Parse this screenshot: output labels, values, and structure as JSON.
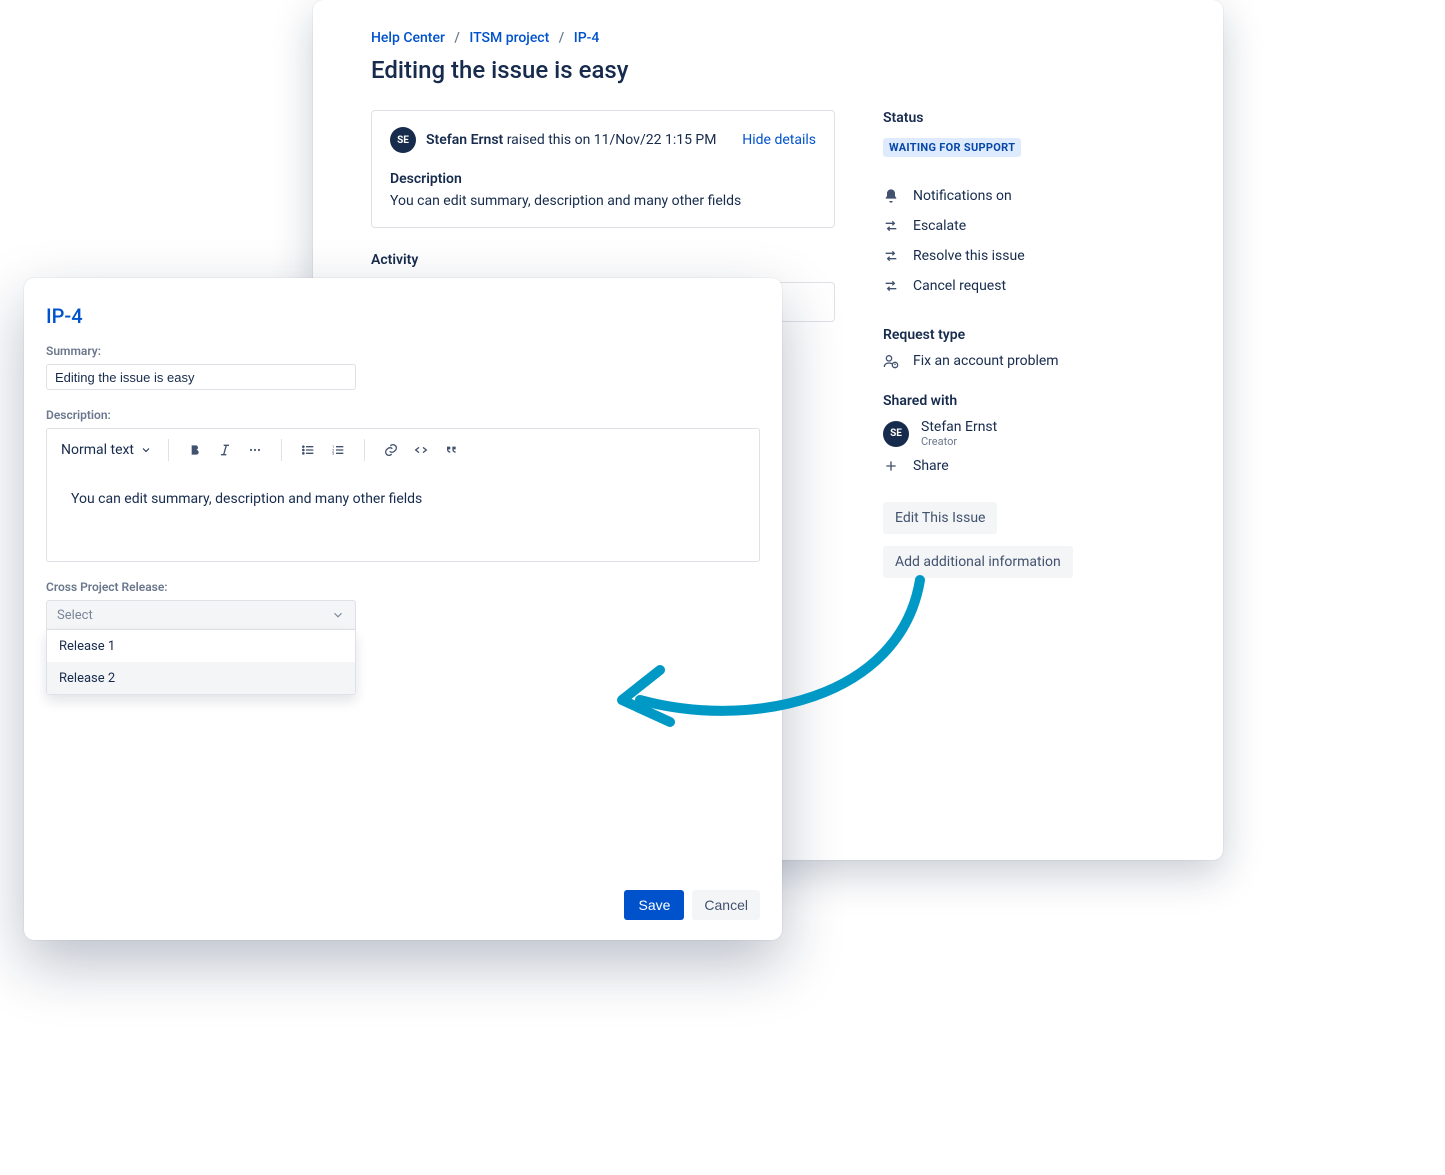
{
  "breadcrumb": {
    "help_center": "Help Center",
    "project": "ITSM project",
    "key": "IP-4"
  },
  "issue": {
    "title": "Editing the issue is easy",
    "raiser_initials": "SE",
    "raiser_name": "Stefan Ernst",
    "raised_mid": " raised this on ",
    "raised_on": "11/Nov/22 1:15 PM",
    "hide_details": "Hide details",
    "description_label": "Description",
    "description_text": "You can edit summary, description and many other fields",
    "activity_label": "Activity"
  },
  "sidebar": {
    "status_label": "Status",
    "status_value": "WAITING FOR SUPPORT",
    "actions": [
      {
        "icon": "bell",
        "label": "Notifications on"
      },
      {
        "icon": "swap",
        "label": "Escalate"
      },
      {
        "icon": "swap",
        "label": "Resolve this issue"
      },
      {
        "icon": "swap",
        "label": "Cancel request"
      }
    ],
    "request_type_label": "Request type",
    "request_type_value": "Fix an account problem",
    "shared_label": "Shared with",
    "shared_user_initials": "SE",
    "shared_user_name": "Stefan Ernst",
    "shared_user_role": "Creator",
    "share_action": "Share",
    "edit_btn": "Edit This Issue",
    "add_info_btn": "Add additional information"
  },
  "modal": {
    "key": "IP-4",
    "summary_label": "Summary:",
    "summary_value": "Editing the issue is easy",
    "description_label": "Description:",
    "toolbar": {
      "text_style": "Normal text"
    },
    "description_body": "You can edit summary, description and many other fields",
    "cpr_label": "Cross Project Release:",
    "select_placeholder": "Select",
    "options": [
      "Release 1",
      "Release 2"
    ],
    "save": "Save",
    "cancel": "Cancel"
  }
}
